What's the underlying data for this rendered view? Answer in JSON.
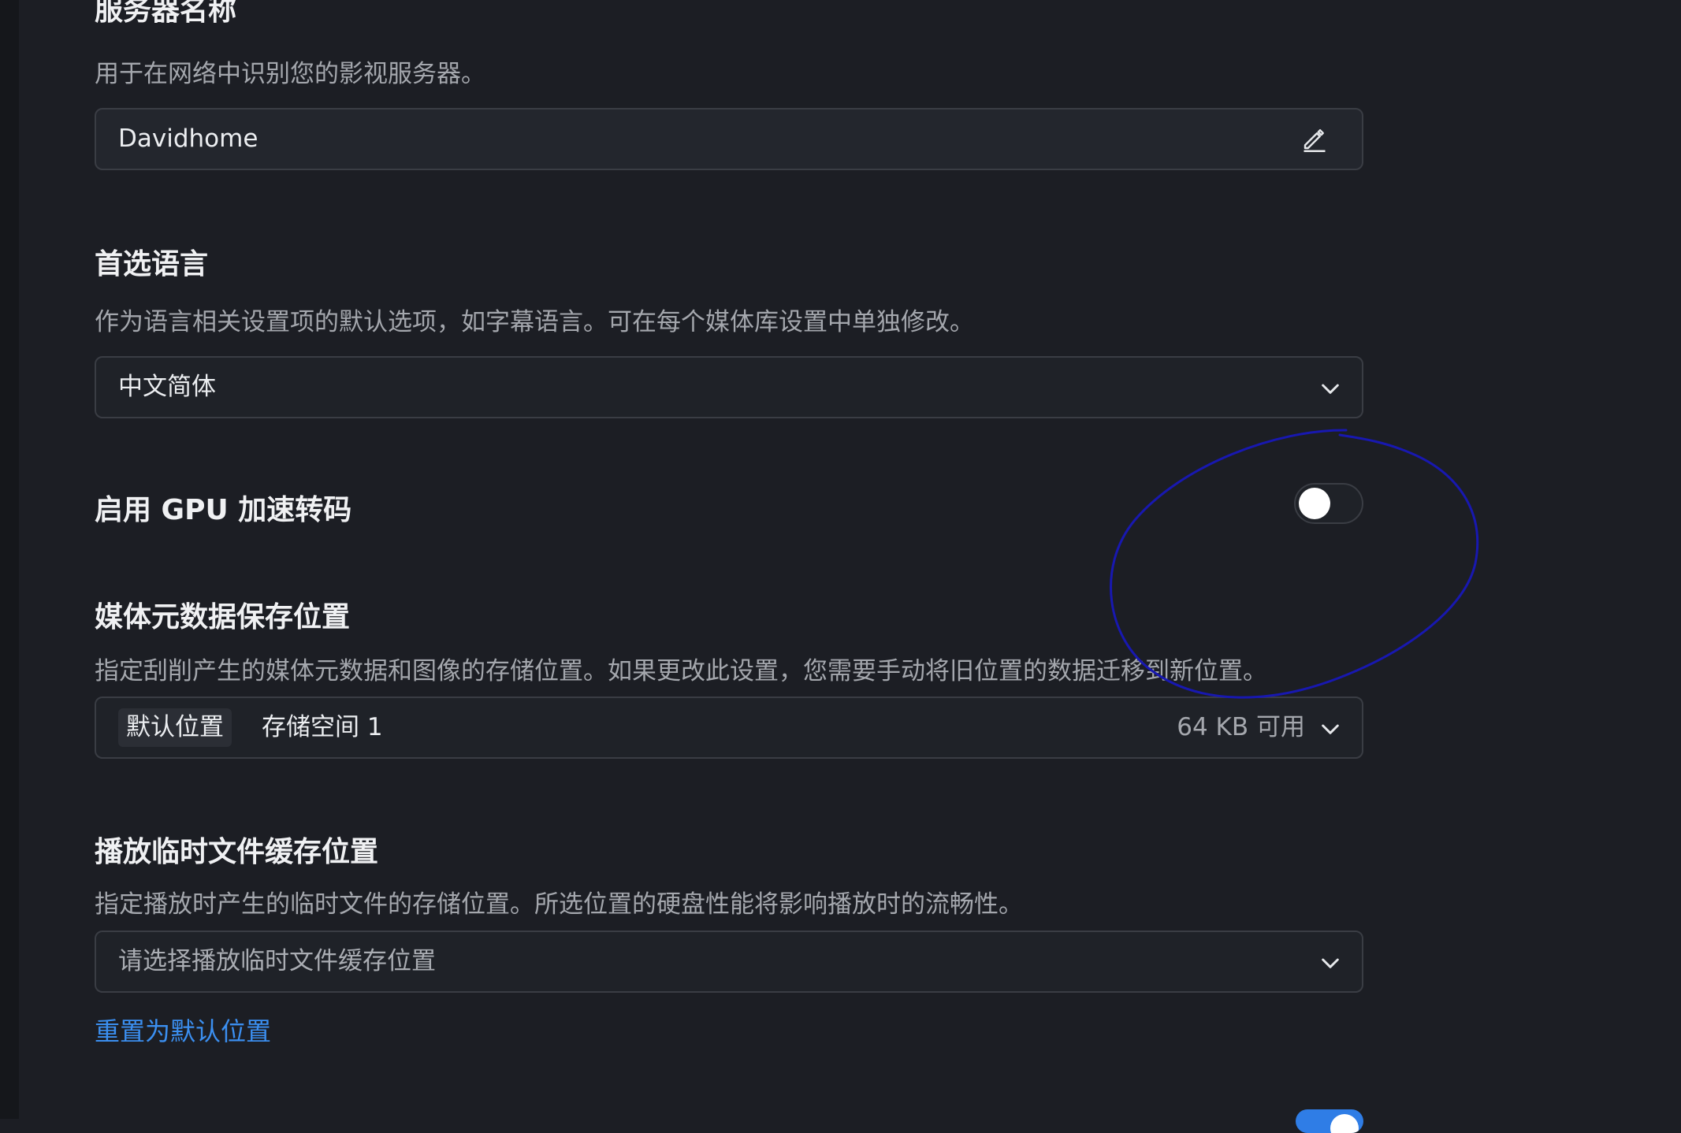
{
  "server_name": {
    "title": "服务器名称",
    "description": "用于在网络中识别您的影视服务器。",
    "value": "Davidhome"
  },
  "preferred_language": {
    "title": "首选语言",
    "description": "作为语言相关设置项的默认选项，如字幕语言。可在每个媒体库设置中单独修改。",
    "selected": "中文简体"
  },
  "gpu_transcode": {
    "title": "启用 GPU 加速转码",
    "enabled": false
  },
  "metadata_location": {
    "title": "媒体元数据保存位置",
    "description": "指定刮削产生的媒体元数据和图像的存储位置。如果更改此设置，您需要手动将旧位置的数据迁移到新位置。",
    "badge": "默认位置",
    "storage": "存储空间 1",
    "available": "64 KB 可用"
  },
  "playback_cache": {
    "title": "播放临时文件缓存位置",
    "description": "指定播放时产生的临时文件的存储位置。所选位置的硬盘性能将影响播放时的流畅性。",
    "placeholder": "请选择播放临时文件缓存位置",
    "reset_link": "重置为默认位置"
  },
  "next_toggle": {
    "enabled": true
  },
  "colors": {
    "background": "#1c1e24",
    "accent": "#3b8ff0",
    "annotation": "#1a1ab0"
  }
}
